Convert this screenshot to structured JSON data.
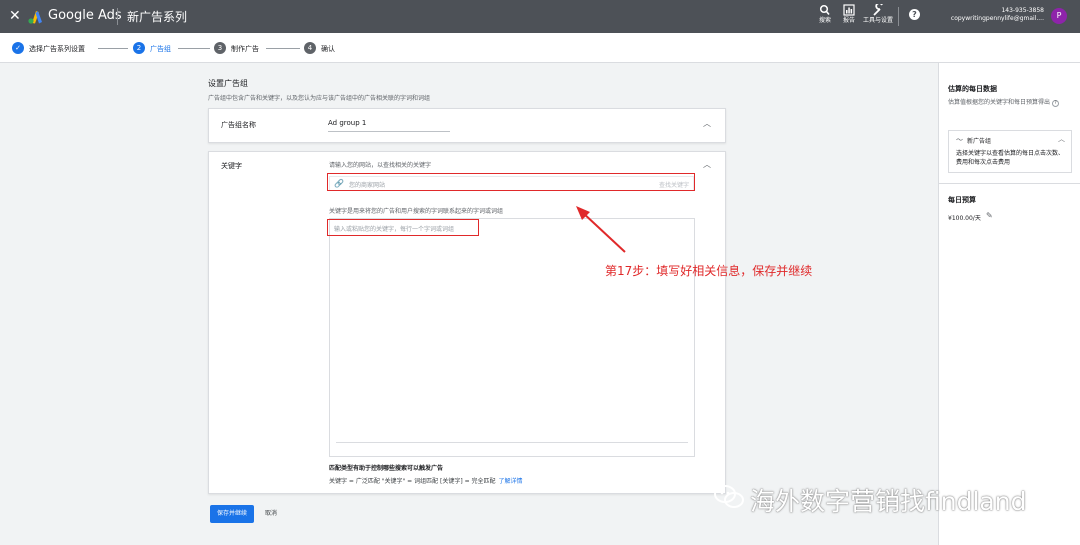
{
  "topbar": {
    "close_icon": "close-icon",
    "brand": "Google Ads",
    "campaign_title": "新广告系列",
    "tools": [
      {
        "label": "搜索",
        "icon": "search-icon"
      },
      {
        "label": "报告",
        "icon": "bar-chart-icon"
      },
      {
        "label": "工具与设置",
        "icon": "wrench-icon"
      }
    ],
    "help_icon": "help-icon",
    "account_id": "143-935-3858",
    "account_email": "copywritingpennylife@gmail....",
    "avatar_letter": "P"
  },
  "stepper": {
    "steps": [
      {
        "num": "✓",
        "label": "选择广告系列设置",
        "state": "done"
      },
      {
        "num": "2",
        "label": "广告组",
        "state": "active"
      },
      {
        "num": "3",
        "label": "制作广告",
        "state": "todo"
      },
      {
        "num": "4",
        "label": "确认",
        "state": "todo"
      }
    ]
  },
  "main": {
    "title": "设置广告组",
    "subtitle": "广告组中包含广告和关键字，以及您认为应与该广告组中的广告相关联的字词和词组",
    "ad_group": {
      "label": "广告组名称",
      "value": "Ad group 1"
    },
    "keywords": {
      "label": "关键字",
      "hint": "请输入您的网站，以查找相关的关键字",
      "url_placeholder": "您的商家网站",
      "search_keywords": "查找关键字",
      "desc": "关键字是用来将您的广告和用户搜索的字词联系起来的字词或词组",
      "textarea_placeholder": "输入或粘贴您的关键字，每行一个字词或词组",
      "match_title": "匹配类型有助于控制哪些搜索可以触发广告",
      "match_desc": "关键字 = 广泛匹配  \"关键字\" = 词组匹配  [关键字] = 完全匹配",
      "learn_more": "了解详情"
    },
    "save_button": "保存并继续",
    "cancel_button": "取消"
  },
  "annotation": "第17步：填写好相关信息，保存并继续",
  "sidebar": {
    "title": "估算的每日数据",
    "subtitle": "估算值根据您的关键字和每日预算得出",
    "card_title": "新广告组",
    "card_desc": "选择关键字以查看估算的每日点击次数、费用和每次点击费用",
    "budget_title": "每日预算",
    "budget_value": "¥100.00/天"
  },
  "watermark": "海外数字营销找findland",
  "colors": {
    "topbar": "#4d5157",
    "primary": "#1a73e8",
    "annotation": "#e0292a",
    "avatar": "#8e24aa"
  }
}
